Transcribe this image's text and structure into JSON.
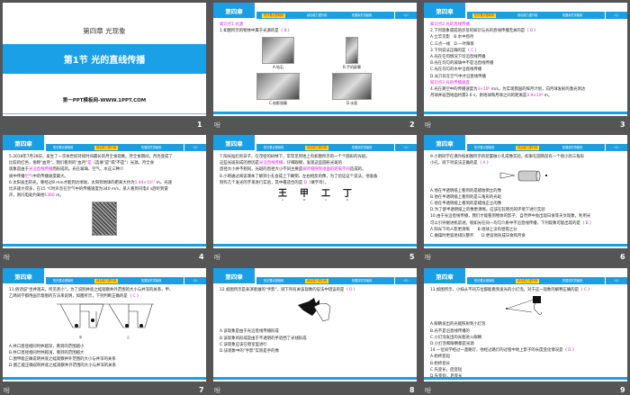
{
  "chapter_label": "第四章",
  "tabs": [
    "知识要点基础练",
    "综合能力提升练",
    "拓展探究突破练"
  ],
  "nav_label": "-◇-",
  "anim_icon": "吩",
  "title_slide": {
    "number": "1",
    "chapter": "第四章  光现象",
    "title": "第1节    光的直线传播",
    "footer": "第一PPT模板网-WWW.1PPT.COM"
  },
  "slides": [
    {
      "number": "2",
      "active_tab": 0,
      "lines": [
        [
          {
            "t": "知识点1  光源",
            "c": "mag"
          }
        ],
        [
          {
            "t": "1.如图所示的物体中属于光源的是（ "
          },
          {
            "t": "B",
            "c": "ans"
          },
          {
            "t": " ）"
          }
        ]
      ],
      "figure": "grid4",
      "images": [
        {
          "label": "A.钻石",
          "icon": "diamond-image"
        },
        {
          "label": "B.手机屏幕",
          "icon": "phone-screen-image"
        },
        {
          "label": "C.电影银幕",
          "icon": "movie-screen-image"
        },
        {
          "label": "D.水面",
          "icon": "water-surface-image"
        }
      ]
    },
    {
      "number": "3",
      "active_tab": 0,
      "lines": [
        [
          {
            "t": "知识点2  光的直线传播",
            "c": "mag"
          }
        ],
        [
          {
            "t": "2.下列现象或成语涉及的知识与光的直线传播无关的是（ "
          },
          {
            "t": "B",
            "c": "ans"
          },
          {
            "t": " ）"
          }
        ],
        [
          {
            "t": "A.立竿见影　B.水中捞月"
          }
        ],
        [
          {
            "t": "C.三点一线　D.一叶障目"
          }
        ],
        [
          {
            "t": "3.下列说法正确的是（ "
          },
          {
            "t": "C",
            "c": "ans"
          },
          {
            "t": " ）"
          }
        ],
        [
          {
            "t": "A.光在任何情况下均沿直线传播"
          }
        ],
        [
          {
            "t": "B.光在均匀的玻璃中不是沿直线传播"
          }
        ],
        [
          {
            "t": "C.光在均匀的水中沿直线传播"
          }
        ],
        [
          {
            "t": "D.光只有在空气中才沿直线传播"
          }
        ],
        [
          {
            "t": "知识点3  光的传播速度",
            "c": "mag"
          }
        ],
        [
          {
            "t": "4.光在真空中的传播速度为"
          },
          {
            "t": "3×10⁸",
            "c": "ans"
          },
          {
            "t": " m/s。为实现我国的探月计划，向月球发射的激光到达"
          }
        ],
        [
          {
            "t": "月球并返回地面约需2.6 s，则地球和月球之间的距离是"
          },
          {
            "t": "3.9×10⁸",
            "c": "ans"
          },
          {
            "t": " m。"
          }
        ]
      ]
    },
    {
      "number": "4",
      "active_tab": 1,
      "lines": [
        [
          {
            "t": "5.2018年7月28日，发生了一次本世纪持续时间最长的月全食现象。月全食期间，月亮变成了"
          }
        ],
        [
          {
            "t": "比较的红色，俗称\"血月\"。我们看到的\"血月\""
          },
          {
            "t": "是",
            "c": "ans"
          },
          {
            "t": "（选填\"是\"或\"不是\"）光源。月全食"
          }
        ],
        [
          {
            "t": "现象是由于"
          },
          {
            "t": "光沿直线传播",
            "c": "ans"
          },
          {
            "t": "而形成的。光在玻璃、空气、水这三种介"
          }
        ],
        [
          {
            "t": "质中传播"
          },
          {
            "t": "空气",
            "c": "ans"
          },
          {
            "t": "中的传播速度最大。"
          }
        ],
        [
          {
            "t": "6.太阳发出的光，要经过8 min才能到达地球，太阳到地球的距离大约为"
          },
          {
            "t": "1.44×10¹¹",
            "c": "ans"
          },
          {
            "t": " m。光速"
          }
        ],
        [
          {
            "t": "比声速大得多，在15 ℃时声音在空气中的传播速度为340 m/s，某人看到闪电4 s后听到雷"
          }
        ],
        [
          {
            "t": "声，则闪电处约离他"
          },
          {
            "t": "1360",
            "c": "ans"
          },
          {
            "t": " m。"
          }
        ]
      ],
      "figure": "photo",
      "images": [
        {
          "label": "",
          "icon": "lightning-photo"
        }
      ]
    },
    {
      "number": "5",
      "active_tab": 1,
      "lines": [
        [
          {
            "t": ""
          }
        ],
        [
          {
            "t": "7.阳光灿烂的日子，在茂密的树林下，常常见到地上有如图所示的一个个圆形的光斑，"
          }
        ],
        [
          {
            "t": "这些光斑形成的原因是"
          },
          {
            "t": "光沿直线传播",
            "c": "ans"
          },
          {
            "t": "，仔细观察，发现这些圆形光斑的"
          }
        ],
        [
          {
            "t": "直径大小并不相同，光斑的直径大小不同主要是"
          },
          {
            "t": "树叶缝隙到地面的距离不同",
            "c": "ans"
          },
          {
            "t": "造成的。"
          }
        ],
        [
          {
            "t": "8.小明通过阅读课本了解到小孔会成上下颠倒、左右相反的像，为了验证这个说法，他准备"
          }
        ],
        [
          {
            "t": "制作几个发光的字来进行实验，其中最适合的是 "
          },
          {
            "t": "D",
            "c": "ans"
          },
          {
            "t": "（填字母）。"
          }
        ]
      ],
      "figure": "chars",
      "images": [
        {
          "label": "王",
          "sub": "A"
        },
        {
          "label": "甲",
          "sub": "B"
        },
        {
          "label": "工",
          "sub": "C"
        },
        {
          "label": "丁",
          "sub": "D"
        }
      ]
    },
    {
      "number": "6",
      "active_tab": 1,
      "lines": [
        [
          {
            "t": "9.小明同学在课外按如图所示的装置做小孔成像实验。如果在圆筒前有一个很小的三角形"
          }
        ],
        [
          {
            "t": "小孔，则下列说法正确的是（ "
          },
          {
            "t": "A",
            "c": "ans"
          },
          {
            "t": " ）"
          }
        ],
        [
          {
            "t": "@fig"
          }
        ],
        [
          {
            "t": "A.他在半透明纸上看到的是蜡烛倒立的像"
          }
        ],
        [
          {
            "t": "B.他在半透明纸上看到的是三角形的光斑"
          }
        ],
        [
          {
            "t": "C.他在半透明纸上看到的是蜡烛正立的像"
          }
        ],
        [
          {
            "t": "D.为了使半透明纸上的像更清晰，应该在较明亮的环境下进行实验"
          }
        ],
        [
          {
            "t": "10.由于光沿直线传播，我们才能看到物体的影子；自然界中会出现日食等天文现象，利用光"
          }
        ],
        [
          {
            "t": "可以引导掘进机前进。假如光在同一均匀介质中不沿直线传播，下列现象可能出现的是（ "
          },
          {
            "t": "B",
            "c": "ans"
          },
          {
            "t": " ）"
          }
        ],
        [
          {
            "t": "A.阳光下的人影更清晰　　B.地球上没有昼夜之分"
          }
        ],
        [
          {
            "t": "C.做操时更容易排队整齐　　D.更容易形成日食和月食"
          }
        ]
      ],
      "figure": "camera",
      "images": [
        {
          "label": "",
          "icon": "pinhole-camera-diagram"
        }
      ]
    },
    {
      "number": "7",
      "active_tab": 1,
      "lines": [
        [
          {
            "t": "11.俗话说\"坐井观天，所见甚小\"。为了说明井底之蛙观察井外范围的大小与井深的关系，甲、"
          }
        ],
        [
          {
            "t": "乙两同学都用画示意图的方法来说明，如图所示，下列判断正确的是（ "
          },
          {
            "t": "C",
            "c": "ans"
          },
          {
            "t": " ）"
          }
        ],
        [
          {
            "t": "@fig"
          }
        ],
        [
          {
            "t": "A.井口直径相同时井越深，看到的范围越小"
          }
        ],
        [
          {
            "t": "B.井口直径相同时井越浅，看到的范围越大"
          }
        ],
        [
          {
            "t": "C.图甲能正确说明井底之蛙观察井外范围的大小与井深的关系"
          }
        ],
        [
          {
            "t": "D.图乙能正确说明井底之蛙观察井外范围的大小与井深的关系"
          }
        ]
      ],
      "figure": "wells",
      "images": [
        {
          "label": "甲",
          "icon": "well-diagram"
        },
        {
          "label": "乙",
          "icon": "well-diagram"
        }
      ]
    },
    {
      "number": "8",
      "active_tab": 1,
      "lines": [
        [
          {
            "t": "12.如图所示是表演者做的\"手影\"，则下列有关该现象的说法中错误的是（ "
          },
          {
            "t": "D",
            "c": "ans"
          },
          {
            "t": " ）"
          }
        ],
        [
          {
            "t": "@fig"
          }
        ],
        [
          {
            "t": "A.该现象是由于光沿直线传播形成"
          }
        ],
        [
          {
            "t": "B.该现象的形成是由于不透明的手遮挡了光线形成"
          }
        ],
        [
          {
            "t": "C.该现象应该在暗室里进行"
          }
        ],
        [
          {
            "t": "D.该现象中的\"手影\"实际是手的像"
          }
        ]
      ],
      "figure": "hand",
      "images": [
        {
          "label": "",
          "icon": "hand-shadow-image"
        }
      ]
    },
    {
      "number": "9",
      "active_tab": 1,
      "lines": [
        [
          {
            "t": "13.如图所示，小妹从不同方位都能看到发光的小灯泡，对于这一现象的解释正确的是（ "
          },
          {
            "t": "C",
            "c": "ans"
          },
          {
            "t": " ）"
          }
        ],
        [
          {
            "t": "@fig"
          }
        ],
        [
          {
            "t": "A.眼睛发出的光能照射到小灯泡"
          }
        ],
        [
          {
            "t": "B.光不是沿直线传播的"
          }
        ],
        [
          {
            "t": "C.小灯泡发出的光能进入眼睛"
          }
        ],
        [
          {
            "t": "D.小灯泡和眼睛都是光源"
          }
        ],
        [
          {
            "t": "14.一位同学经过一盏路灯，他经过路灯的过程中地上影子的长度变化情况是（ "
          },
          {
            "t": "D",
            "c": "ans"
          },
          {
            "t": " ）"
          }
        ],
        [
          {
            "t": "A.始终变短"
          }
        ],
        [
          {
            "t": "B.始终变长"
          }
        ],
        [
          {
            "t": "C.先变长，后变短"
          }
        ],
        [
          {
            "t": "D.先变短，后变长"
          }
        ]
      ],
      "figure": "eye",
      "images": [
        {
          "label": "",
          "icon": "eye-lamp-diagram"
        }
      ]
    }
  ],
  "colors": {
    "accent": "#1b9fe4",
    "tab_active": "#ffe000",
    "answer": "#e020e0",
    "background": "#555555"
  }
}
